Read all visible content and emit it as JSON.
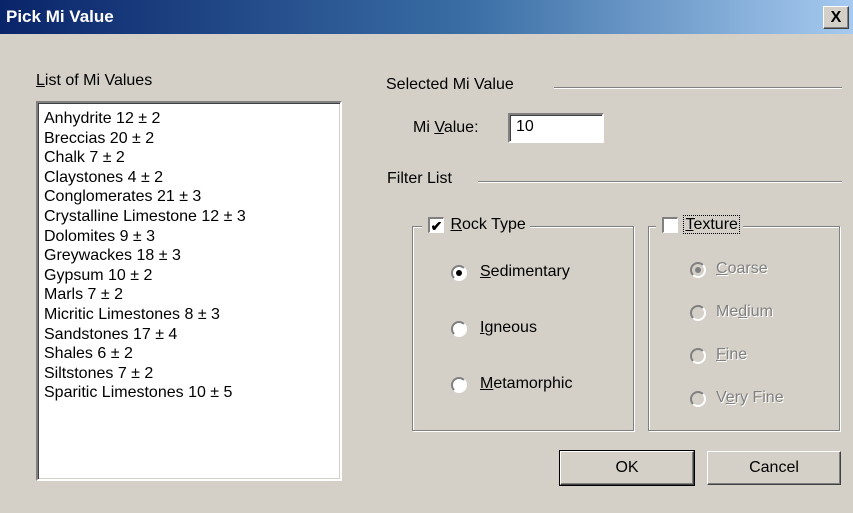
{
  "window": {
    "title": "Pick Mi Value",
    "close_glyph": "X"
  },
  "list": {
    "label_prefix": "",
    "label_mnemonic": "L",
    "label_rest": "ist of Mi Values",
    "items": [
      "Anhydrite   12 ± 2",
      "Breccias   20 ± 2",
      "Chalk   7 ± 2",
      "Claystones   4 ± 2",
      "Conglomerates   21 ± 3",
      "Crystalline Limestone   12 ± 3",
      "Dolomites   9 ± 3",
      "Greywackes   18 ± 3",
      "Gypsum   10 ± 2",
      "Marls   7 ± 2",
      "Micritic Limestones   8 ± 3",
      "Sandstones   17 ± 4",
      "Shales   6 ± 2",
      "Siltstones   7 ± 2",
      "Sparitic Limestones   10 ± 5"
    ]
  },
  "selected": {
    "group_label": "Selected Mi Value",
    "mi_label_prefix": "Mi ",
    "mi_label_mnemonic": "V",
    "mi_label_rest": "alue:",
    "mi_value": "10"
  },
  "filter": {
    "group_label": "Filter List",
    "rock_type": {
      "checked": true,
      "label_mnemonic": "R",
      "label_rest": "ock Type",
      "options": [
        {
          "mnemonic": "S",
          "rest": "edimentary",
          "selected": true
        },
        {
          "mnemonic": "I",
          "rest": "gneous",
          "selected": false
        },
        {
          "mnemonic": "M",
          "rest": "etamorphic",
          "selected": false
        }
      ]
    },
    "texture": {
      "checked": false,
      "label_mnemonic": "T",
      "label_rest": "exture",
      "options": [
        {
          "prefix": "",
          "mnemonic": "C",
          "rest": "oarse",
          "selected": true
        },
        {
          "prefix": "Me",
          "mnemonic": "d",
          "rest": "ium",
          "selected": false
        },
        {
          "prefix": "",
          "mnemonic": "F",
          "rest": "ine",
          "selected": false
        },
        {
          "prefix": "V",
          "mnemonic": "e",
          "rest": "ry Fine",
          "selected": false
        }
      ]
    }
  },
  "buttons": {
    "ok": "OK",
    "cancel": "Cancel"
  }
}
